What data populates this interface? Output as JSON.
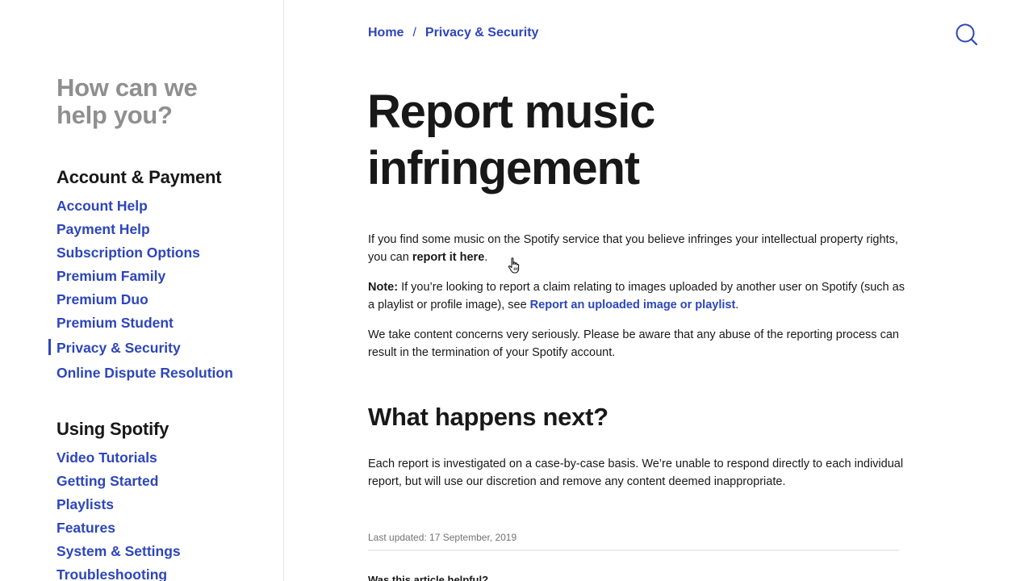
{
  "sidebar": {
    "heading": "How can we help you?",
    "sections": [
      {
        "title": "Account & Payment",
        "items": [
          "Account Help",
          "Payment Help",
          "Subscription Options",
          "Premium Family",
          "Premium Duo",
          "Premium Student",
          "Privacy & Security",
          "Online Dispute Resolution"
        ],
        "active_item": "Privacy & Security"
      },
      {
        "title": "Using Spotify",
        "items": [
          "Video Tutorials",
          "Getting Started",
          "Playlists",
          "Features",
          "System & Settings",
          "Troubleshooting"
        ]
      }
    ]
  },
  "breadcrumb": {
    "home": "Home",
    "separator": "/",
    "current": "Privacy & Security"
  },
  "header": {
    "search_icon": "search-icon"
  },
  "article": {
    "title_line1": "Report music",
    "title_line2": "infringement",
    "p1_text": "If you find some music on the Spotify service that you believe infringes your intellectual property rights, you can ",
    "p1_link": "report it here",
    "p1_end": ".",
    "p2_label": "Note:",
    "p2_text": " If you’re looking to report a claim relating to images uploaded by another user on Spotify (such as a playlist or profile image), see ",
    "p2_link": "Report an uploaded image or playlist",
    "p2_end": ".",
    "p3_text": "We take content concerns very seriously. Please be aware that any abuse of the reporting process can result in the termination of your Spotify account.",
    "subheading": "What happens next?",
    "p4_text": "Each report is investigated on a case-by-case basis. We’re unable to respond directly to each individual report, but will use our discretion and remove any content deemed inappropriate.",
    "last_updated": "Last updated: 17 September, 2019",
    "helpful_question": "Was this article helpful?"
  },
  "colors": {
    "link": "#2d46b9",
    "text": "#181818",
    "muted": "#8f8f8f"
  }
}
